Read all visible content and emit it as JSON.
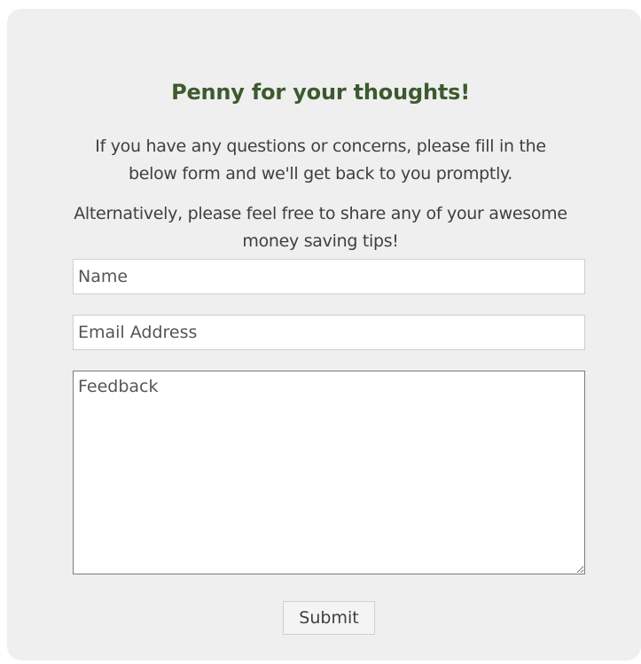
{
  "form": {
    "title": "Penny for your thoughts!",
    "intro_line1": "If you have any questions or concerns, please fill in the",
    "intro_line2": "below form and we'll get back to you promptly.",
    "alt_line1": "Alternatively, please feel free to share any of your awesome",
    "alt_line2": "money saving tips!",
    "name_placeholder": "Name",
    "email_placeholder": "Email Address",
    "feedback_placeholder": "Feedback",
    "submit_label": "Submit"
  },
  "colors": {
    "card_background": "#efefef",
    "title": "#3d5a2e",
    "text": "#3f3f3f"
  }
}
